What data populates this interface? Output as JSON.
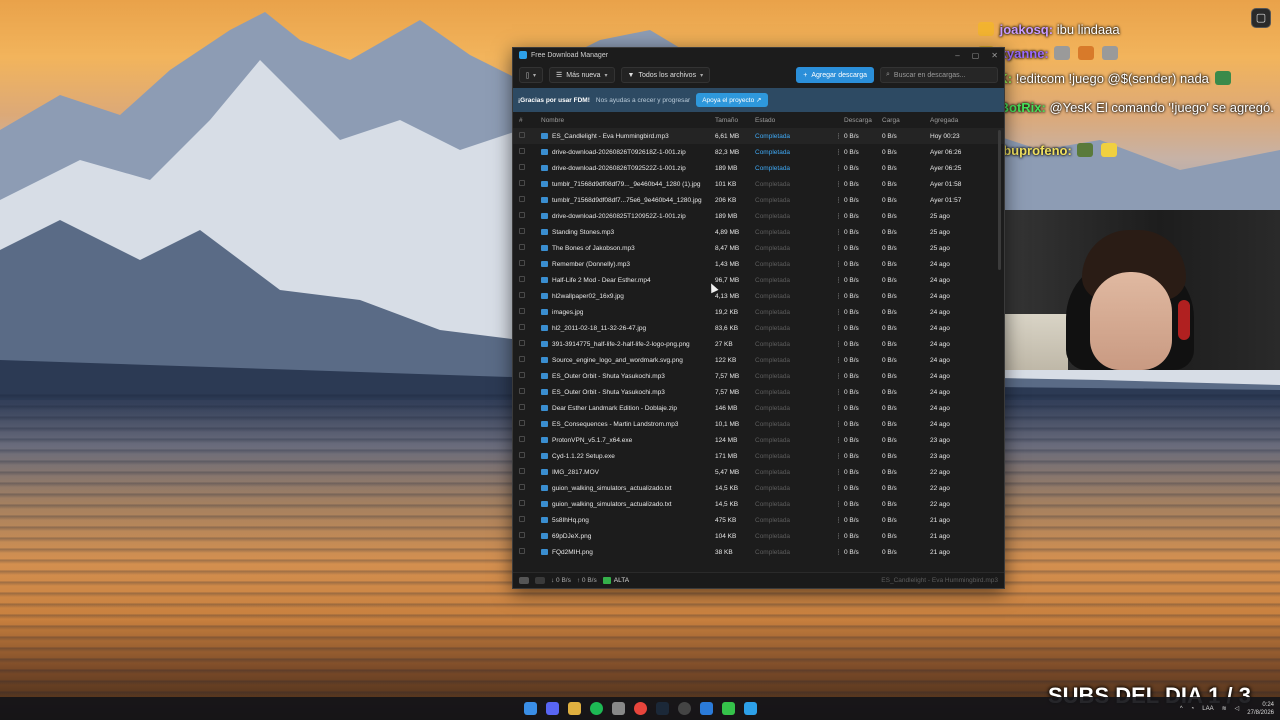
{
  "fdm": {
    "window_title": "Free Download Manager",
    "toolbar": {
      "more_label": "Más nueva",
      "filter_label": "Todos los archivos",
      "add_label": "Agregar descarga",
      "search_placeholder": "Buscar en descargas..."
    },
    "banner": {
      "thanks": "¡Gracias por usar FDM!",
      "sub": "Nos ayudas a crecer y progresar",
      "button": "Apoya el proyecto"
    },
    "columns": {
      "num": "#",
      "name": "Nombre",
      "size": "Tamaño",
      "status": "Estado",
      "download": "Descarga",
      "upload": "Carga",
      "added": "Agregada"
    },
    "rows": [
      {
        "name": "ES_Candlelight - Eva Hummingbird.mp3",
        "size": "6,61 MB",
        "status": "Completada",
        "down": "0 B/s",
        "up": "0 B/s",
        "added": "Hoy 00:23",
        "active": true
      },
      {
        "name": "drive-download-20260826T092618Z-1-001.zip",
        "size": "82,3 MB",
        "status": "Completada",
        "down": "0 B/s",
        "up": "0 B/s",
        "added": "Ayer 06:26",
        "active": true
      },
      {
        "name": "drive-download-20260826T092522Z-1-001.zip",
        "size": "189 MB",
        "status": "Completada",
        "down": "0 B/s",
        "up": "0 B/s",
        "added": "Ayer 06:25",
        "active": true
      },
      {
        "name": "tumblr_71568d9df08df79..._9e460b44_1280 (1).jpg",
        "size": "101 KB",
        "status": "Completada",
        "down": "0 B/s",
        "up": "0 B/s",
        "added": "Ayer 01:58",
        "active": false
      },
      {
        "name": "tumblr_71568d9df08df7...75e6_9e460b44_1280.jpg",
        "size": "206 KB",
        "status": "Completada",
        "down": "0 B/s",
        "up": "0 B/s",
        "added": "Ayer 01:57",
        "active": false
      },
      {
        "name": "drive-download-20260825T120952Z-1-001.zip",
        "size": "189 MB",
        "status": "Completada",
        "down": "0 B/s",
        "up": "0 B/s",
        "added": "25 ago",
        "active": false
      },
      {
        "name": "Standing Stones.mp3",
        "size": "4,89 MB",
        "status": "Completada",
        "down": "0 B/s",
        "up": "0 B/s",
        "added": "25 ago",
        "active": false
      },
      {
        "name": "The Bones of Jakobson.mp3",
        "size": "8,47 MB",
        "status": "Completada",
        "down": "0 B/s",
        "up": "0 B/s",
        "added": "25 ago",
        "active": false
      },
      {
        "name": "Remember (Donnelly).mp3",
        "size": "1,43 MB",
        "status": "Completada",
        "down": "0 B/s",
        "up": "0 B/s",
        "added": "24 ago",
        "active": false
      },
      {
        "name": "Half-Life 2 Mod - Dear Esther.mp4",
        "size": "96,7 MB",
        "status": "Completada",
        "down": "0 B/s",
        "up": "0 B/s",
        "added": "24 ago",
        "active": false
      },
      {
        "name": "hl2wallpaper02_16x9.jpg",
        "size": "4,13 MB",
        "status": "Completada",
        "down": "0 B/s",
        "up": "0 B/s",
        "added": "24 ago",
        "active": false
      },
      {
        "name": "images.jpg",
        "size": "19,2 KB",
        "status": "Completada",
        "down": "0 B/s",
        "up": "0 B/s",
        "added": "24 ago",
        "active": false
      },
      {
        "name": "hl2_2011-02-18_11-32-26-47.jpg",
        "size": "83,6 KB",
        "status": "Completada",
        "down": "0 B/s",
        "up": "0 B/s",
        "added": "24 ago",
        "active": false
      },
      {
        "name": "391-3914775_half-life-2-half-life-2-logo-png.png",
        "size": "27 KB",
        "status": "Completada",
        "down": "0 B/s",
        "up": "0 B/s",
        "added": "24 ago",
        "active": false
      },
      {
        "name": "Source_engine_logo_and_wordmark.svg.png",
        "size": "122 KB",
        "status": "Completada",
        "down": "0 B/s",
        "up": "0 B/s",
        "added": "24 ago",
        "active": false
      },
      {
        "name": "ES_Outer Orbit - Shuta Yasukochi.mp3",
        "size": "7,57 MB",
        "status": "Completada",
        "down": "0 B/s",
        "up": "0 B/s",
        "added": "24 ago",
        "active": false
      },
      {
        "name": "ES_Outer Orbit - Shuta Yasukochi.mp3",
        "size": "7,57 MB",
        "status": "Completada",
        "down": "0 B/s",
        "up": "0 B/s",
        "added": "24 ago",
        "active": false
      },
      {
        "name": "Dear Esther Landmark Edition - Doblaje.zip",
        "size": "146 MB",
        "status": "Completada",
        "down": "0 B/s",
        "up": "0 B/s",
        "added": "24 ago",
        "active": false
      },
      {
        "name": "ES_Consequences - Martin Landstrom.mp3",
        "size": "10,1 MB",
        "status": "Completada",
        "down": "0 B/s",
        "up": "0 B/s",
        "added": "24 ago",
        "active": false
      },
      {
        "name": "ProtonVPN_v5.1.7_x64.exe",
        "size": "124 MB",
        "status": "Completada",
        "down": "0 B/s",
        "up": "0 B/s",
        "added": "23 ago",
        "active": false
      },
      {
        "name": "Cyd-1.1.22 Setup.exe",
        "size": "171 MB",
        "status": "Completada",
        "down": "0 B/s",
        "up": "0 B/s",
        "added": "23 ago",
        "active": false
      },
      {
        "name": "IMG_2817.MOV",
        "size": "5,47 MB",
        "status": "Completada",
        "down": "0 B/s",
        "up": "0 B/s",
        "added": "22 ago",
        "active": false
      },
      {
        "name": "guion_walking_simulators_actualizado.txt",
        "size": "14,5 KB",
        "status": "Completada",
        "down": "0 B/s",
        "up": "0 B/s",
        "added": "22 ago",
        "active": false
      },
      {
        "name": "guion_walking_simulators_actualizado.txt",
        "size": "14,5 KB",
        "status": "Completada",
        "down": "0 B/s",
        "up": "0 B/s",
        "added": "22 ago",
        "active": false
      },
      {
        "name": "5s8IhHq.png",
        "size": "475 KB",
        "status": "Completada",
        "down": "0 B/s",
        "up": "0 B/s",
        "added": "21 ago",
        "active": false
      },
      {
        "name": "69pDJeX.png",
        "size": "104 KB",
        "status": "Completada",
        "down": "0 B/s",
        "up": "0 B/s",
        "added": "21 ago",
        "active": false
      },
      {
        "name": "FQd2MIH.png",
        "size": "38 KB",
        "status": "Completada",
        "down": "0 B/s",
        "up": "0 B/s",
        "added": "21 ago",
        "active": false
      }
    ],
    "statusbar": {
      "down": "↓ 0 B/s",
      "up": "↑ 0 B/s",
      "priority": "ALTA",
      "current": "ES_Candlelight - Eva Hummingbird.mp3"
    }
  },
  "chat": [
    {
      "user": "joakosq:",
      "msg": "ibu lindaaa",
      "color": "#c99cff"
    },
    {
      "user": "kyanne:",
      "msg": "",
      "color": "#9b6bff"
    },
    {
      "user": "YesK:",
      "msg": "!editcom !juego @$(sender) nada",
      "color": "#9cff5a"
    },
    {
      "user": "BotRix:",
      "msg": "@YesK El comando '!juego' se agregó.",
      "color": "#46e05a"
    },
    {
      "user": "ibuprofeno:",
      "msg": "",
      "color": "#f0e060"
    }
  ],
  "overlay": {
    "subs": "SUBS DEL DIA 1 / 3"
  },
  "tray": {
    "lang": "LAA",
    "time": "0:24",
    "date": "27/8/2026"
  },
  "colors": {
    "accent": "#2b8fd9",
    "done": "#3fa9f5",
    "banner": "#2d4a63"
  }
}
